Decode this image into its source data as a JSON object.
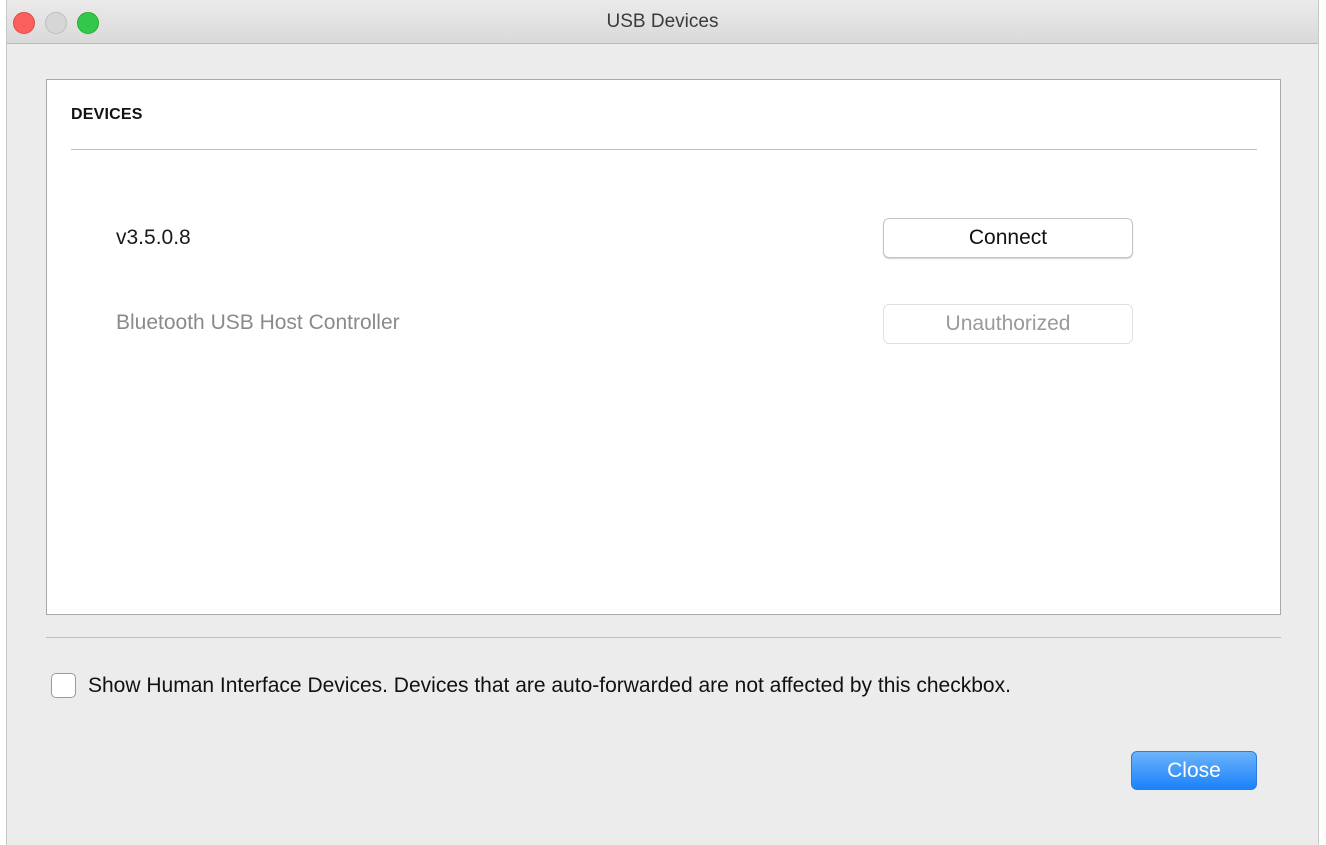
{
  "window": {
    "title": "USB Devices"
  },
  "devices": {
    "header": "DEVICES",
    "items": [
      {
        "name": "v3.5.0.8",
        "action_label": "Connect",
        "enabled": true
      },
      {
        "name": "Bluetooth USB Host Controller",
        "action_label": "Unauthorized",
        "enabled": false
      }
    ]
  },
  "options": {
    "hid_checkbox_label": "Show Human Interface Devices. Devices that are auto-forwarded are not affected by this checkbox.",
    "hid_checked": false
  },
  "footer": {
    "close_label": "Close"
  },
  "colors": {
    "primary_button": "#1a82fb",
    "close_light": "#fc605c",
    "zoom_light": "#34c84a"
  }
}
